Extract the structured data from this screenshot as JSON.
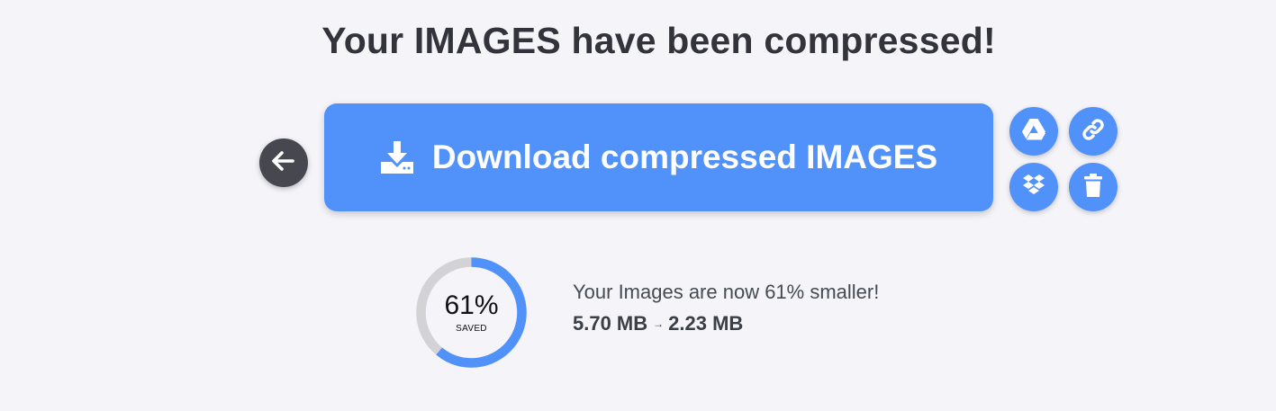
{
  "header": {
    "title": "Your IMAGES have been compressed!"
  },
  "actions": {
    "back_icon": "arrow-left-icon",
    "download_label": "Download compressed IMAGES",
    "download_icon": "download-tray-icon",
    "side_buttons": [
      {
        "name": "google-drive",
        "icon": "google-drive-icon"
      },
      {
        "name": "copy-link",
        "icon": "link-icon"
      },
      {
        "name": "dropbox",
        "icon": "dropbox-icon"
      },
      {
        "name": "delete",
        "icon": "trash-icon"
      }
    ]
  },
  "result": {
    "percent_saved": 61,
    "percent_label": "61%",
    "saved_label": "SAVED",
    "summary_text": "Your Images are now 61% smaller!",
    "original_size": "5.70 MB",
    "arrow": "→",
    "compressed_size": "2.23 MB"
  },
  "colors": {
    "accent": "#5191fa",
    "ring_track": "#d3d3d6",
    "back_button": "#47474f",
    "background": "#f4f4f9"
  }
}
